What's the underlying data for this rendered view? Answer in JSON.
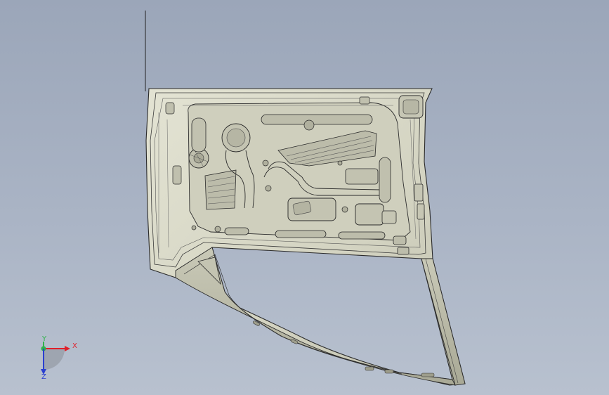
{
  "viewport": {
    "name": "3d-graphics-area",
    "background_top": "#9ba6b9",
    "background_bottom": "#b8c1cf"
  },
  "model": {
    "part": "car-door-inner-panel",
    "shade_color": "#d6d6c4",
    "edge_color": "#2a2a2a"
  },
  "triad": {
    "x_label": "X",
    "y_label": "Y",
    "z_label": "Z",
    "x_color": "#e0202a",
    "y_color": "#2fb34a",
    "z_color": "#2a3fd0"
  }
}
